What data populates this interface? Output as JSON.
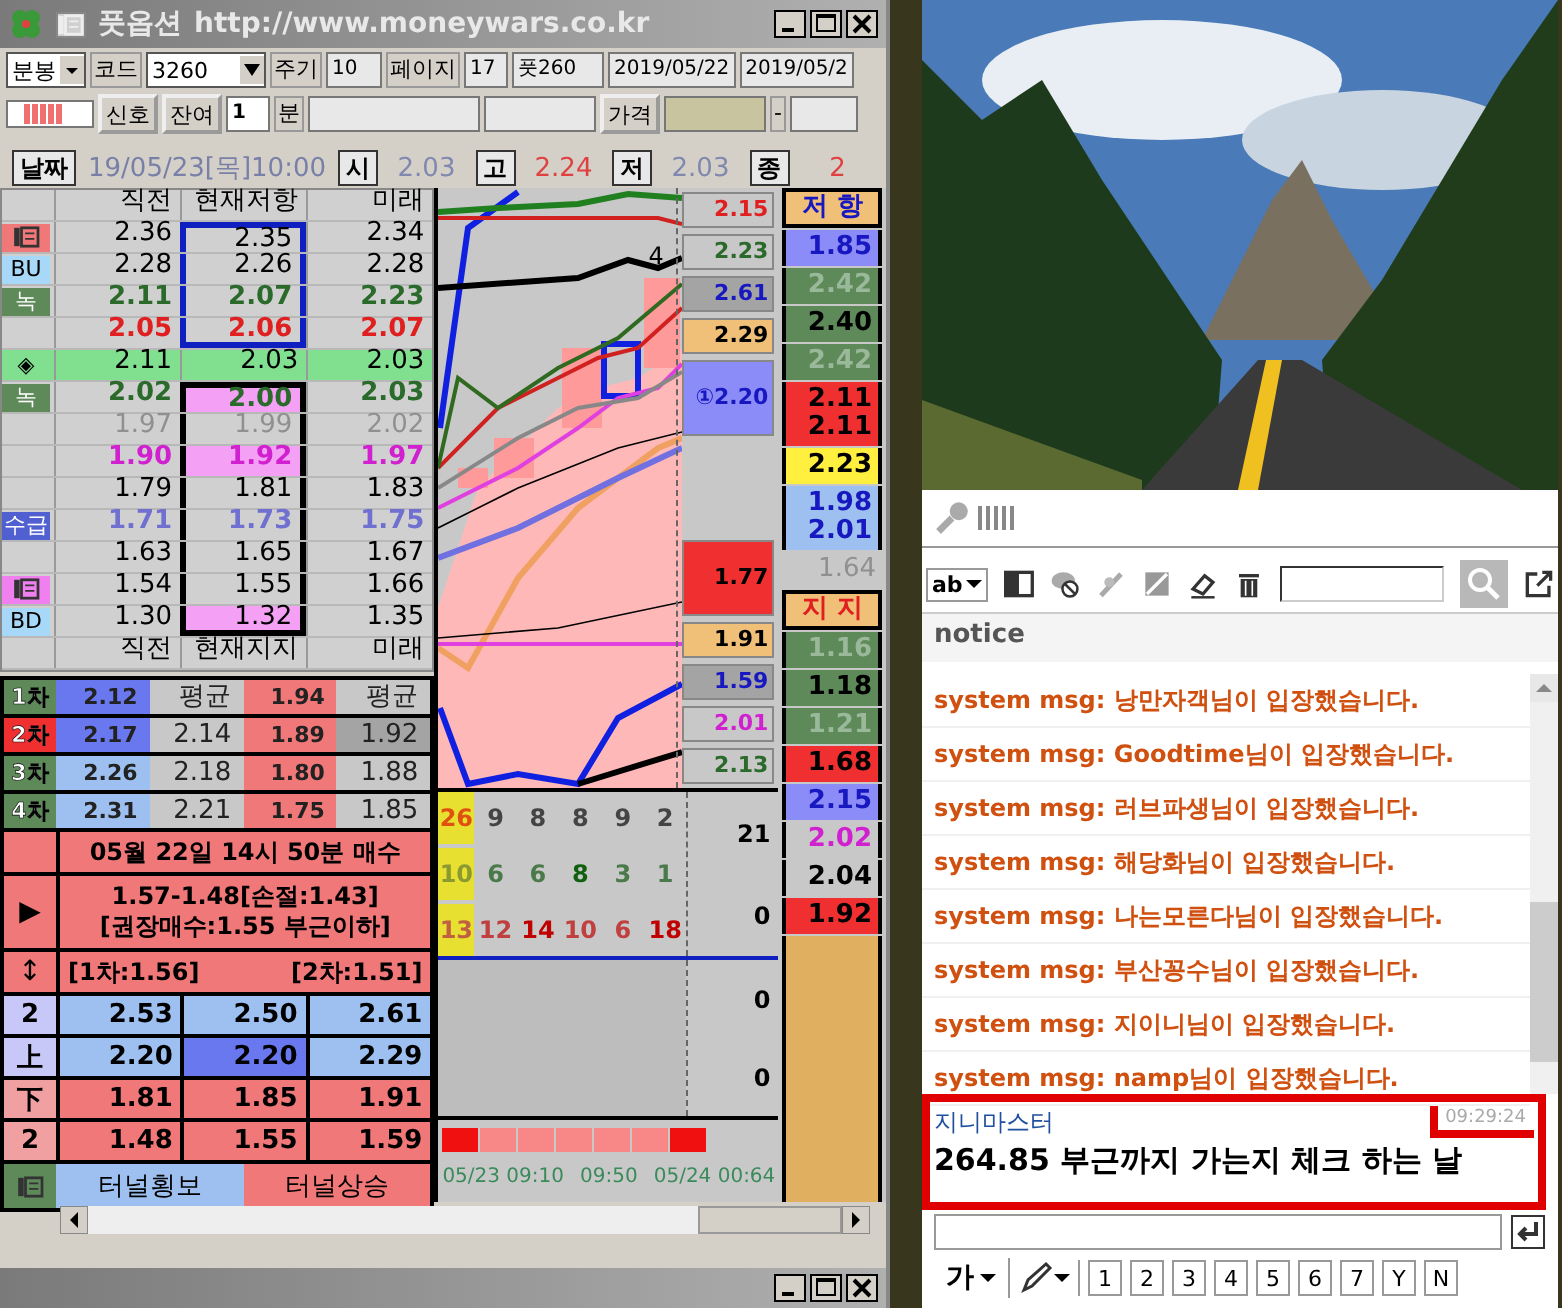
{
  "window": {
    "title": "풋옵션",
    "url": "http://www.moneywars.co.kr"
  },
  "toolbar": {
    "period_type": "분봉",
    "code_label": "코드",
    "code": "3260",
    "cycle_label": "주기",
    "cycle": "10",
    "page_label": "페이지",
    "page": "17",
    "put": "풋260",
    "date_from": "2019/05/22",
    "date_to": "2019/05/2"
  },
  "toolbar2": {
    "signal_button": "신호",
    "remaining_button": "잔여",
    "minutes": "1",
    "minutes_unit": "분",
    "price_button": "가격",
    "dash": "-"
  },
  "quote": {
    "date_button": "날짜",
    "datetime": "19/05/23[목]10:00",
    "items": [
      {
        "label": "시",
        "value": "2.03",
        "color": "#8088b0"
      },
      {
        "label": "고",
        "value": "2.24",
        "color": "#e04040"
      },
      {
        "label": "저",
        "value": "2.03",
        "color": "#8088b0"
      },
      {
        "label": "종",
        "value": "2",
        "color": "#e04040"
      }
    ]
  },
  "levels": {
    "header": [
      "직전",
      "현재저항",
      "미래"
    ],
    "footer": [
      "직전",
      "현재지지",
      "미래"
    ],
    "rows": [
      {
        "tag": {
          "kind": "icon",
          "color": "#f07878"
        },
        "values": [
          "2.36",
          "2.35",
          "2.34"
        ],
        "color": "#000000",
        "bold": false,
        "kind": "resistance",
        "band": false,
        "pink": false
      },
      {
        "tag": {
          "kind": "text",
          "text": "BU",
          "color": "#a8d8f8"
        },
        "values": [
          "2.28",
          "2.26",
          "2.28"
        ],
        "color": "#000000",
        "bold": false,
        "kind": "resistance",
        "band": false,
        "pink": false
      },
      {
        "tag": {
          "kind": "text",
          "text": "녹",
          "color": "#5e8a5a"
        },
        "values": [
          "2.11",
          "2.07",
          "2.23"
        ],
        "color": "#2a6a2a",
        "bold": true,
        "kind": "resistance",
        "band": false,
        "pink": false
      },
      {
        "values": [
          "2.05",
          "2.06",
          "2.07"
        ],
        "color": "#e02020",
        "bold": true,
        "kind": "resistance",
        "band": false,
        "pink": false
      },
      {
        "tag": {
          "kind": "text",
          "text": "◈",
          "color": "#80e090"
        },
        "values": [
          "2.11",
          "2.03",
          "2.03"
        ],
        "color": "#000000",
        "bold": false,
        "kind": "middle",
        "band": true,
        "pink": false
      },
      {
        "tag": {
          "kind": "text",
          "text": "녹",
          "color": "#5e8a5a"
        },
        "values": [
          "2.02",
          "2.00",
          "2.03"
        ],
        "color": "#2a6a2a",
        "bold": true,
        "kind": "support",
        "band": false,
        "pink": true
      },
      {
        "values": [
          "1.97",
          "1.99",
          "2.02"
        ],
        "color": "#909090",
        "bold": false,
        "kind": "support",
        "band": false,
        "pink": false
      },
      {
        "values": [
          "1.90",
          "1.92",
          "1.97"
        ],
        "color": "#d020d0",
        "bold": true,
        "kind": "support",
        "band": false,
        "pink": true
      },
      {
        "values": [
          "1.79",
          "1.81",
          "1.83"
        ],
        "color": "#000000",
        "bold": false,
        "kind": "support",
        "band": false,
        "pink": false
      },
      {
        "tag": {
          "kind": "text",
          "text": "수급",
          "color": "#5060d0"
        },
        "values": [
          "1.71",
          "1.73",
          "1.75"
        ],
        "color": "#7070d0",
        "bold": true,
        "kind": "support",
        "band": false,
        "pink": false
      },
      {
        "values": [
          "1.63",
          "1.65",
          "1.67"
        ],
        "color": "#000000",
        "bold": false,
        "kind": "support",
        "band": false,
        "pink": false
      },
      {
        "tag": {
          "kind": "icon",
          "color": "#f080f0"
        },
        "values": [
          "1.54",
          "1.55",
          "1.66"
        ],
        "color": "#000000",
        "bold": false,
        "kind": "support",
        "band": false,
        "pink": false
      },
      {
        "tag": {
          "kind": "text",
          "text": "BD",
          "color": "#a8d8f8"
        },
        "values": [
          "1.30",
          "1.32",
          "1.35"
        ],
        "color": "#000000",
        "bold": false,
        "kind": "support",
        "band": false,
        "pink": true
      }
    ]
  },
  "orders": [
    {
      "label": "1차",
      "color": "#5e8a5a",
      "cells": [
        {
          "text": "2.12",
          "color": "#6a78f0"
        },
        {
          "text": "평균",
          "color": "#c8c8c8"
        },
        {
          "text": "1.94",
          "color": "#f07878"
        },
        {
          "text": "평균",
          "color": "#c8c8c8"
        }
      ]
    },
    {
      "label": "2차",
      "color": "#f03030",
      "cells": [
        {
          "text": "2.17",
          "color": "#6a78f0"
        },
        {
          "text": "2.14",
          "color": "#c8c8c8"
        },
        {
          "text": "1.89",
          "color": "#f07878"
        },
        {
          "text": "1.92",
          "color": "#a4a4a4"
        }
      ]
    },
    {
      "label": "3차",
      "color": "#5e8a5a",
      "cells": [
        {
          "text": "2.26",
          "color": "#9ec0f0"
        },
        {
          "text": "2.18",
          "color": "#c8c8c8"
        },
        {
          "text": "1.80",
          "color": "#f07878"
        },
        {
          "text": "1.88",
          "color": "#c8c8c8"
        }
      ]
    },
    {
      "label": "4차",
      "color": "#5e8a5a",
      "cells": [
        {
          "text": "2.31",
          "color": "#9ec0f0"
        },
        {
          "text": "2.21",
          "color": "#c8c8c8"
        },
        {
          "text": "1.75",
          "color": "#f07878"
        },
        {
          "text": "1.85",
          "color": "#c8c8c8"
        }
      ]
    }
  ],
  "signal": {
    "banner": "05월 22일 14시 50분 매수",
    "play_mark": "▶",
    "lines": [
      "1.57-1.48[손절:1.43]",
      "[권장매수:1.55 부근이하]"
    ],
    "range_mark": "↕",
    "first": "[1차:1.56]",
    "second": "[2차:1.51]"
  },
  "bands": [
    {
      "label": "2",
      "color": "#c8c8f8",
      "cells": [
        {
          "text": "2.53",
          "color": "#9ec0f0"
        },
        {
          "text": "2.50",
          "color": "#9ec0f0"
        },
        {
          "text": "2.61",
          "color": "#9ec0f0"
        }
      ]
    },
    {
      "label": "上",
      "color": "#c8c8f8",
      "cells": [
        {
          "text": "2.20",
          "color": "#9ec0f0"
        },
        {
          "text": "2.20",
          "color": "#6a78f0"
        },
        {
          "text": "2.29",
          "color": "#9ec0f0"
        }
      ]
    },
    {
      "label": "下",
      "color": "#f0a0a0",
      "cells": [
        {
          "text": "1.81",
          "color": "#f07878"
        },
        {
          "text": "1.85",
          "color": "#f07878"
        },
        {
          "text": "1.91",
          "color": "#f07878"
        }
      ]
    },
    {
      "label": "2",
      "color": "#f0a0a0",
      "cells": [
        {
          "text": "1.48",
          "color": "#f07878"
        },
        {
          "text": "1.55",
          "color": "#f07878"
        },
        {
          "text": "1.59",
          "color": "#f07878"
        }
      ]
    }
  ],
  "tunnel": [
    {
      "text": "터널횡보",
      "color": "#9ec0f0"
    },
    {
      "text": "터널상승",
      "color": "#f07878"
    }
  ],
  "chart": {
    "line_label": "4",
    "upper_boxes": [
      {
        "value": {
          "text": "2.15",
          "color": "#e02020"
        },
        "color": "#c8c8c8",
        "tall": false
      },
      {
        "value": {
          "text": "2.23",
          "color": "#2a6a2a"
        },
        "color": "#c8c8c8",
        "tall": false
      },
      {
        "value": {
          "text": "2.61",
          "color": "#1818c0"
        },
        "color": "#a4a4a4",
        "tall": false
      },
      {
        "value": {
          "text": "2.29",
          "color": "#000000"
        },
        "color": "#f0c078",
        "tall": false
      },
      {
        "value": {
          "text": "①2.20",
          "color": "#1818c0"
        },
        "color": "#8c8cf8",
        "tall": true
      }
    ],
    "lower_boxes": [
      {
        "value": {
          "text": "1.77",
          "color": "#000000"
        },
        "color": "#f03030",
        "tall": true
      },
      {
        "value": {
          "text": "1.91",
          "color": "#000000"
        },
        "color": "#f0c078",
        "tall": false
      },
      {
        "value": {
          "text": "1.59",
          "color": "#1818c0"
        },
        "color": "#a4a4a4",
        "tall": false
      },
      {
        "value": {
          "text": "2.01",
          "color": "#d020d0"
        },
        "color": "#c8c8c8",
        "tall": false
      },
      {
        "value": {
          "text": "2.13",
          "color": "#2a6a2a"
        },
        "color": "#c8c8c8",
        "tall": false
      }
    ],
    "grid": [
      {
        "cells": [
          {
            "text": "26",
            "color": "#e05010"
          },
          {
            "text": "9",
            "color": "#444444"
          },
          {
            "text": "8",
            "color": "#444444"
          },
          {
            "text": "8",
            "color": "#444444"
          },
          {
            "text": "9",
            "color": "#444444"
          },
          {
            "text": "2",
            "color": "#444444"
          }
        ]
      },
      {
        "cells": [
          {
            "text": "10",
            "color": "#8a9a30"
          },
          {
            "text": "6",
            "color": "#4a7a4a"
          },
          {
            "text": "6",
            "color": "#4a7a4a"
          },
          {
            "text": "8",
            "color": "#106010"
          },
          {
            "text": "3",
            "color": "#4a7a4a"
          },
          {
            "text": "1",
            "color": "#4a7a4a"
          }
        ]
      },
      {
        "cells": [
          {
            "text": "13",
            "color": "#c06040"
          },
          {
            "text": "12",
            "color": "#c04040"
          },
          {
            "text": "14",
            "color": "#c00000"
          },
          {
            "text": "10",
            "color": "#c04040"
          },
          {
            "text": "6",
            "color": "#c04040"
          },
          {
            "text": "18",
            "color": "#c00000"
          }
        ]
      }
    ],
    "grid_axis": [
      "21",
      "0"
    ],
    "lower_axis": [
      "0",
      "0"
    ],
    "strip": [
      {
        "on": true
      },
      {
        "on": false
      },
      {
        "on": false
      },
      {
        "on": false
      },
      {
        "on": false
      },
      {
        "on": false
      },
      {
        "on": true
      }
    ],
    "times": [
      "05/23 09:10",
      "09:50",
      "05/24 00:64"
    ]
  },
  "side": {
    "resistance_header": "저 항",
    "support_header": "지 지",
    "items": [
      {
        "kind": "box",
        "lines": [
          {
            "text": "1.85",
            "color": "#1818c0"
          }
        ],
        "color": "#8c8cf8"
      },
      {
        "kind": "box",
        "lines": [
          {
            "text": "2.42",
            "color": "#9ab89a"
          }
        ],
        "color": "#5e8a5a"
      },
      {
        "kind": "box",
        "lines": [
          {
            "text": "2.40",
            "color": "#000000"
          }
        ],
        "color": "#5e8a5a"
      },
      {
        "kind": "box",
        "lines": [
          {
            "text": "2.42",
            "color": "#9ab89a"
          }
        ],
        "color": "#5e8a5a"
      },
      {
        "kind": "box",
        "lines": [
          {
            "text": "2.11",
            "color": "#000000"
          },
          {
            "text": "2.11",
            "color": "#000000"
          }
        ],
        "color": "#f03030"
      },
      {
        "kind": "box",
        "lines": [
          {
            "text": "2.23",
            "color": "#000000"
          }
        ],
        "color": "#fff040"
      },
      {
        "kind": "box",
        "lines": [
          {
            "text": "1.98",
            "color": "#1818c0"
          },
          {
            "text": "2.01",
            "color": "#1818c0"
          }
        ],
        "color": "#9ec0f0"
      },
      {
        "kind": "plain",
        "lines": [
          {
            "text": "1.64",
            "color": "#909090"
          }
        ],
        "color": "#c8c8c8"
      },
      {
        "kind": "header"
      },
      {
        "kind": "box",
        "lines": [
          {
            "text": "1.16",
            "color": "#9ab89a"
          }
        ],
        "color": "#5e8a5a"
      },
      {
        "kind": "box",
        "lines": [
          {
            "text": "1.18",
            "color": "#000000"
          }
        ],
        "color": "#5e8a5a"
      },
      {
        "kind": "box",
        "lines": [
          {
            "text": "1.21",
            "color": "#9ab89a"
          }
        ],
        "color": "#5e8a5a"
      },
      {
        "kind": "box",
        "lines": [
          {
            "text": "1.68",
            "color": "#000000"
          }
        ],
        "color": "#f03030"
      },
      {
        "kind": "box",
        "lines": [
          {
            "text": "2.15",
            "color": "#1818c0"
          }
        ],
        "color": "#8c8cf8"
      },
      {
        "kind": "box",
        "lines": [
          {
            "text": "2.02",
            "color": "#d020d0"
          }
        ],
        "color": "#c8c8c8"
      },
      {
        "kind": "box",
        "lines": [
          {
            "text": "2.04",
            "color": "#000000"
          }
        ],
        "color": "#c8c8c8"
      },
      {
        "kind": "box",
        "lines": [
          {
            "text": "1.92",
            "color": "#000000"
          }
        ],
        "color": "#f03030"
      },
      {
        "kind": "empty",
        "color": "#e0b060"
      }
    ]
  },
  "chat": {
    "format_button": "ab",
    "notice": "notice",
    "messages": [
      {
        "text": "system msg: 낭만자객님이 입장했습니다."
      },
      {
        "text": "system msg: Goodtime님이 입장했습니다."
      },
      {
        "text": "system msg: 러브파생님이 입장했습니다."
      },
      {
        "text": "system msg: 해당화님이 입장했습니다."
      },
      {
        "text": "system msg: 나는모른다님이 입장했습니다."
      },
      {
        "text": "system msg: 부산꽁수님이 입장했습니다."
      },
      {
        "text": "system msg: 지이니님이 입장했습니다."
      },
      {
        "text": "system msg: namp님이 입장했습니다."
      }
    ],
    "highlight": {
      "author": "지니마스터",
      "time": "09:29:24",
      "text": "264.85 부근까지 가는지 체크 하는 날"
    },
    "font_button": "가",
    "quick_buttons": [
      "1",
      "2",
      "3",
      "4",
      "5",
      "6",
      "7",
      "Y",
      "N"
    ]
  }
}
